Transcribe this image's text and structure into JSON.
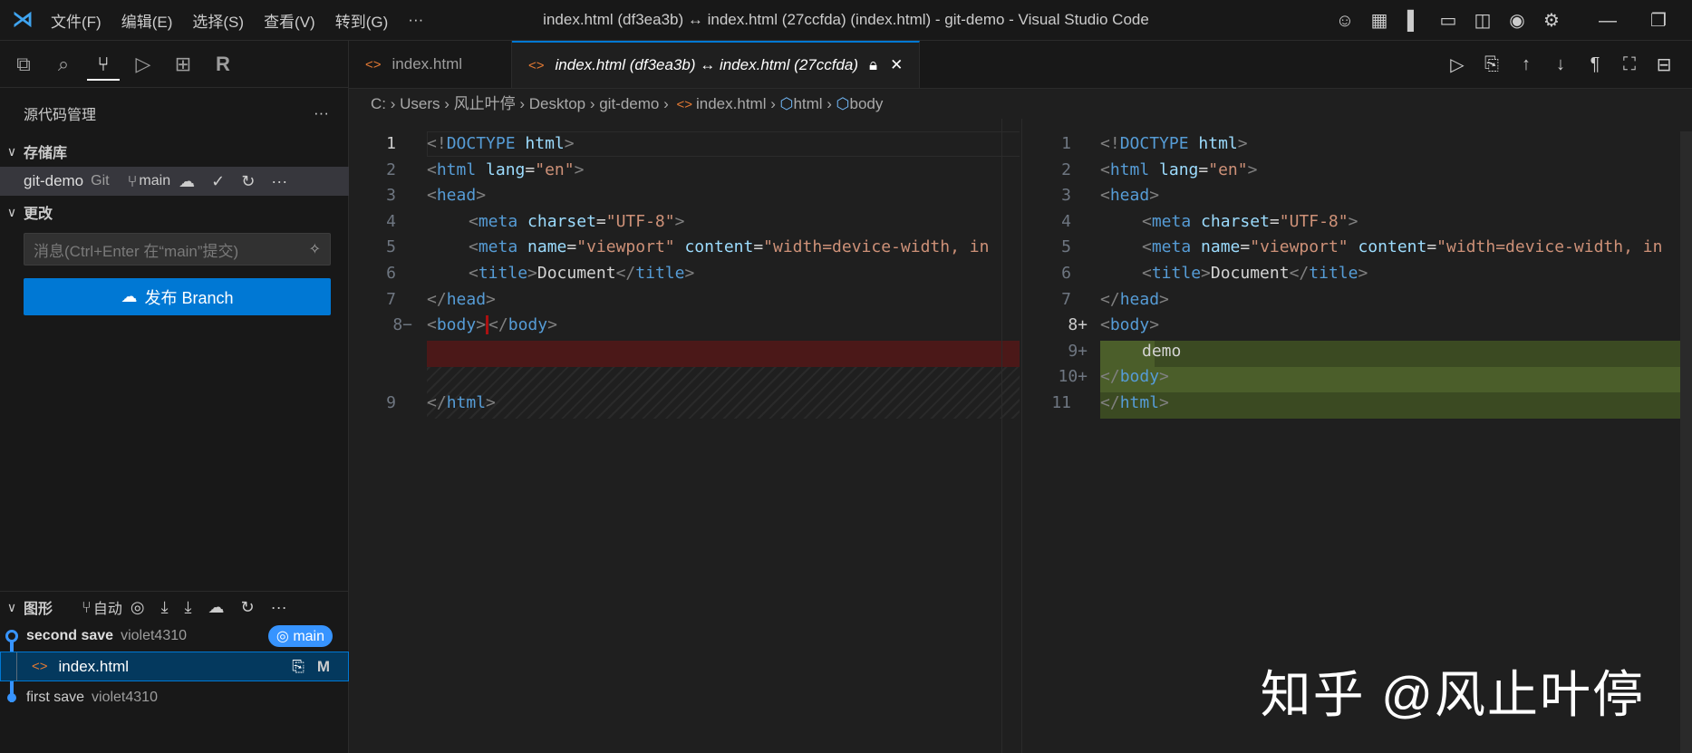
{
  "titlebar": {
    "menus": [
      "文件(F)",
      "编辑(E)",
      "选择(S)",
      "查看(V)",
      "转到(G)",
      "···"
    ],
    "title": "index.html (df3ea3b) ↔ index.html (27ccfda) (index.html) - git-demo - Visual Studio Code"
  },
  "sidebar": {
    "title": "源代码管理",
    "more": "···",
    "repos_header": "存储库",
    "repo": {
      "name": "git-demo",
      "type": "Git",
      "branch": "main"
    },
    "changes_header": "更改",
    "message_placeholder": "消息(Ctrl+Enter 在“main”提交)",
    "publish_label": "发布 Branch",
    "graph": {
      "header": "图形",
      "auto": "自动",
      "commits": [
        {
          "message": "second save",
          "author": "violet4310",
          "badge": "main"
        },
        {
          "message": "first save",
          "author": "violet4310"
        }
      ],
      "file": {
        "name": "index.html",
        "status": "M"
      }
    }
  },
  "tabs": [
    {
      "label": "index.html"
    },
    {
      "label": "index.html (df3ea3b) ↔ index.html (27ccfda)"
    }
  ],
  "breadcrumb": [
    "C:",
    "Users",
    "风止叶停",
    "Desktop",
    "git-demo",
    "index.html",
    "html",
    "body"
  ],
  "left_lines": [
    {
      "n": "1"
    },
    {
      "n": "2"
    },
    {
      "n": "3"
    },
    {
      "n": "4"
    },
    {
      "n": "5"
    },
    {
      "n": "6"
    },
    {
      "n": "7"
    },
    {
      "n": "8−"
    },
    {
      "n": "9"
    }
  ],
  "right_lines": [
    {
      "n": "1"
    },
    {
      "n": "2"
    },
    {
      "n": "3"
    },
    {
      "n": "4"
    },
    {
      "n": "5"
    },
    {
      "n": "6"
    },
    {
      "n": "7"
    },
    {
      "n": "8+"
    },
    {
      "n": "9+"
    },
    {
      "n": "10+"
    },
    {
      "n": "11"
    }
  ],
  "code": {
    "doctype": "DOCTYPE",
    "html_kw": "html",
    "lang_attr": "lang",
    "en": "\"en\"",
    "head": "head",
    "meta": "meta",
    "charset": "charset",
    "utf8": "\"UTF-8\"",
    "name": "name",
    "viewport": "\"viewport\"",
    "content": "content",
    "width": "\"width=device-width, in",
    "title": "title",
    "document": "Document",
    "body": "body",
    "demo": "demo"
  },
  "watermark": "知乎 @风止叶停"
}
